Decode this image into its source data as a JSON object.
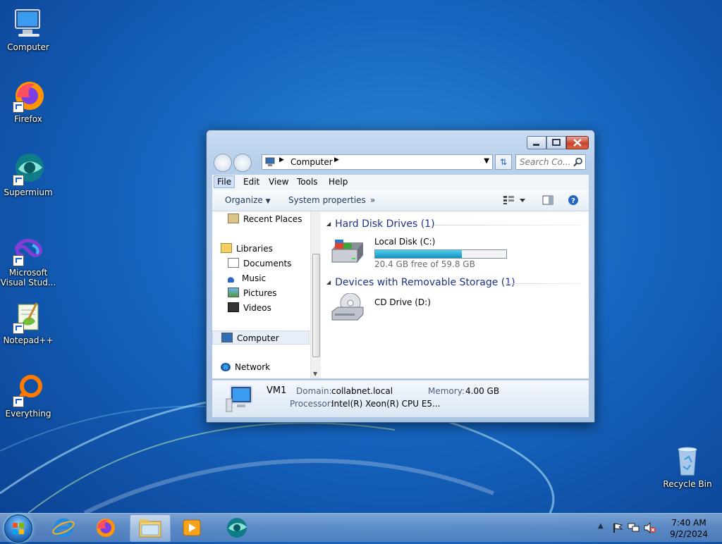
{
  "colors": {
    "accent": "#1e3287",
    "desktop": "#1565c0",
    "progress": "#1592be"
  },
  "desktop": {
    "icons": [
      {
        "label": "Computer",
        "icon": "computer-icon"
      },
      {
        "label": "Firefox",
        "icon": "firefox-icon"
      },
      {
        "label": "Supermium",
        "icon": "supermium-icon"
      },
      {
        "label": "Microsoft Visual Stud...",
        "icon": "visual-studio-icon"
      },
      {
        "label": "Notepad++",
        "icon": "notepadpp-icon"
      },
      {
        "label": "Everything",
        "icon": "everything-icon"
      },
      {
        "label": "Recycle Bin",
        "icon": "recycle-bin-icon"
      }
    ]
  },
  "explorer": {
    "address": "Computer",
    "search_placeholder": "Search Co...",
    "menu": [
      "File",
      "Edit",
      "View",
      "Tools",
      "Help"
    ],
    "toolbar": {
      "organize": "Organize",
      "system_properties": "System properties",
      "more": "»"
    },
    "nav": {
      "recent_places": "Recent Places",
      "libraries": "Libraries",
      "documents": "Documents",
      "music": "Music",
      "pictures": "Pictures",
      "videos": "Videos",
      "computer": "Computer",
      "network": "Network"
    },
    "groups": {
      "hdd_title": "Hard Disk Drives (1)",
      "removable_title": "Devices with Removable Storage (1)"
    },
    "drives": {
      "local_name": "Local Disk (C:)",
      "local_free": "20.4 GB free of 59.8 GB",
      "local_used_fraction": 0.66,
      "cd_name": "CD Drive (D:)"
    },
    "details": {
      "name": "VM1",
      "domain_label": "Domain:",
      "domain": "collabnet.local",
      "memory_label": "Memory:",
      "memory": "4.00 GB",
      "processor_label": "Processor:",
      "processor": "Intel(R) Xeon(R) CPU E5..."
    }
  },
  "taskbar": {
    "items": [
      "start-orb",
      "internet-explorer-icon",
      "firefox-icon",
      "windows-explorer-icon",
      "media-player-icon",
      "supermium-icon"
    ],
    "time": "7:40 AM",
    "date": "9/2/2024"
  }
}
